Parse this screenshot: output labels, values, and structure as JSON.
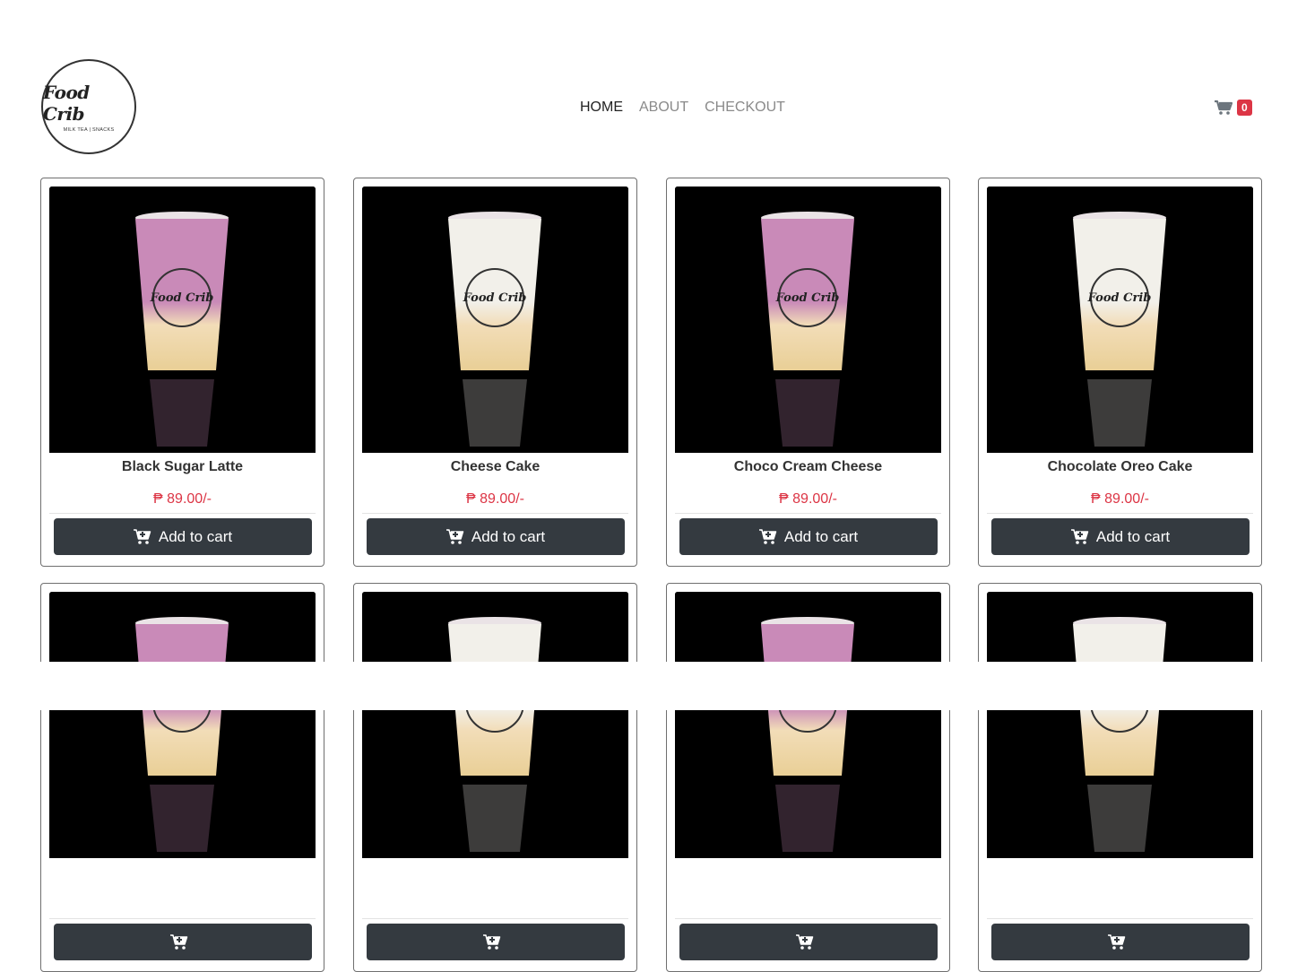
{
  "header": {
    "logo": {
      "title": "Food Crib",
      "subtitle": "MILK TEA | SNACKS"
    },
    "nav": [
      {
        "label": "HOME",
        "active": true
      },
      {
        "label": "ABOUT",
        "active": false
      },
      {
        "label": "CHECKOUT",
        "active": false
      }
    ],
    "cart": {
      "icon": "cart-icon",
      "count": "0"
    }
  },
  "colors": {
    "accent": "#dc3545",
    "button": "#343a40",
    "taro": "#c98ab8",
    "cheese": "#f2ddb8",
    "cream": "#f2f0ea"
  },
  "products": [
    {
      "name": "Black Sugar Latte",
      "price": "₱ 89.00/-",
      "button_label": "Add to cart",
      "style": "taro"
    },
    {
      "name": "Cheese Cake",
      "price": "₱ 89.00/-",
      "button_label": "Add to cart",
      "style": "cream"
    },
    {
      "name": "Choco Cream Cheese",
      "price": "₱ 89.00/-",
      "button_label": "Add to cart",
      "style": "taro"
    },
    {
      "name": "Chocolate Oreo Cake",
      "price": "₱ 89.00/-",
      "button_label": "Add to cart",
      "style": "cream"
    },
    {
      "name": "",
      "price": "",
      "button_label": "",
      "style": "taro"
    },
    {
      "name": "",
      "price": "",
      "button_label": "",
      "style": "cream"
    },
    {
      "name": "",
      "price": "",
      "button_label": "",
      "style": "taro"
    },
    {
      "name": "",
      "price": "",
      "button_label": "",
      "style": "cream"
    }
  ]
}
